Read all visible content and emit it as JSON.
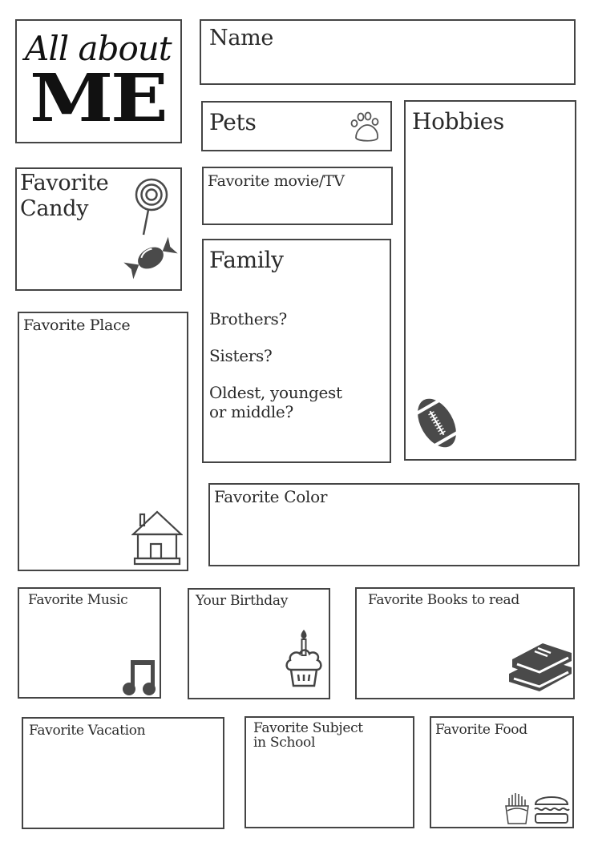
{
  "header": {
    "title_line1": "All about",
    "title_line2": "ME"
  },
  "sections": {
    "name": "Name",
    "pets": "Pets",
    "hobbies": "Hobbies",
    "favorite_candy": "Favorite\nCandy",
    "favorite_movie_tv": "Favorite movie/TV",
    "family": {
      "title": "Family",
      "questions": [
        "Brothers?",
        "Sisters?",
        "Oldest, youngest\nor middle?"
      ]
    },
    "favorite_place": "Favorite Place",
    "favorite_color": "Favorite Color",
    "favorite_music": "Favorite Music",
    "your_birthday": "Your Birthday",
    "favorite_books": "Favorite Books to read",
    "favorite_vacation": "Favorite Vacation",
    "favorite_subject": "Favorite Subject\nin School",
    "favorite_food": "Favorite Food"
  },
  "icons": {
    "pets": "paw-icon",
    "candy": [
      "lollipop-icon",
      "wrapped-candy-icon"
    ],
    "hobbies": "football-icon",
    "place": "house-icon",
    "music": "music-note-icon",
    "birthday": "cupcake-icon",
    "books": "books-icon",
    "food": [
      "fries-icon",
      "burger-icon"
    ]
  },
  "colors": {
    "border": "#444444",
    "icon_fill": "#4a4a4a",
    "text": "#2a2a2a"
  }
}
